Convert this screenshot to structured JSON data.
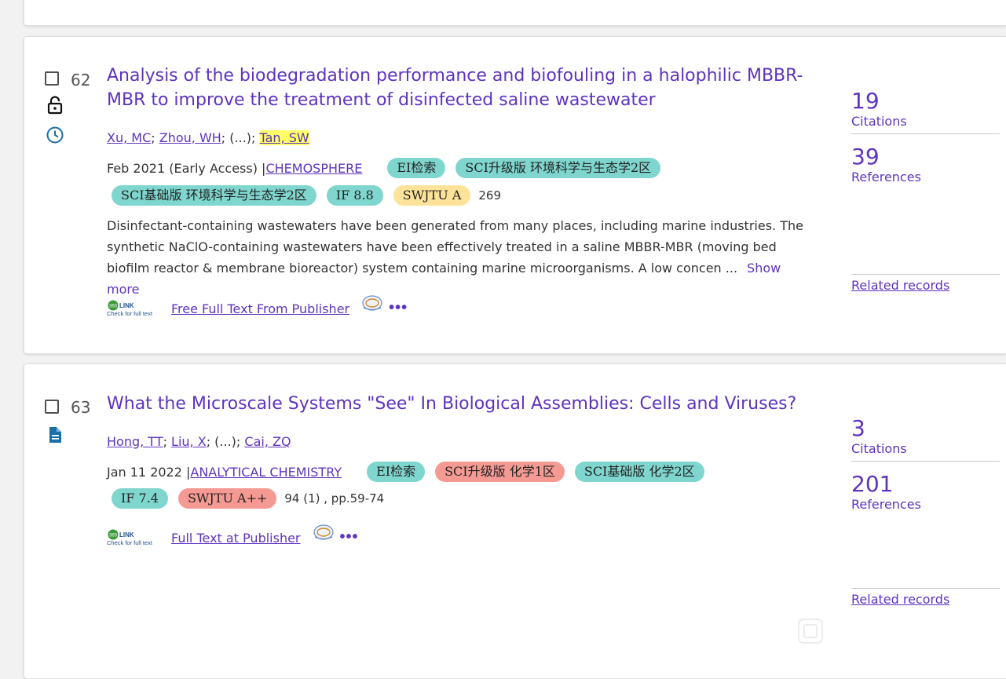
{
  "records": [
    {
      "number": "62",
      "title": "Analysis of the biodegradation performance and biofouling in a halophilic MBBR-MBR to improve the treatment of disinfected saline wastewater",
      "authors": {
        "a1": "Xu, MC",
        "a2": "Zhou, WH",
        "sep": "; (...); ",
        "a3": "Tan, SW"
      },
      "date": "Feb 2021 (Early Access) | ",
      "journal": "CHEMOSPHERE",
      "badges": [
        "EI检索",
        "SCI升级版 环境科学与生态学2区",
        "SCI基础版 环境科学与生态学2区",
        "IF 8.8",
        "SWJTU A"
      ],
      "volume": "269",
      "abstract": "Disinfectant-containing wastewaters have been generated from many places, including marine industries. The synthetic NaClO-containing wastewaters have been effectively treated in a saline MBBR-MBR (moving bed biofilm reactor & membrane bioreactor) system containing marine microorganisms. A low concen ...",
      "show_more": "Show more",
      "link360_alt": "360LINK Check for full text",
      "fulltext": "Free Full Text From Publisher",
      "more": "•••",
      "citations": "19",
      "citations_label": "Citations",
      "references": "39",
      "references_label": "References",
      "related": "Related records",
      "icons": [
        "lock-open-icon",
        "clock-icon"
      ]
    },
    {
      "number": "63",
      "title": "What the Microscale Systems \"See\" In Biological Assemblies: Cells and Viruses?",
      "authors": {
        "a1": "Hong, TT",
        "a2": "Liu, X",
        "sep": "; (...); ",
        "a3": "Cai, ZQ"
      },
      "date": "Jan 11 2022 | ",
      "journal": "ANALYTICAL CHEMISTRY",
      "badges": [
        "EI检索",
        "SCI升级版 化学1区",
        "SCI基础版 化学2区",
        "IF 7.4",
        "SWJTU A++"
      ],
      "volume": "94 (1) , pp.59-74",
      "link360_alt": "360LINK Check for full text",
      "fulltext": "Full Text at Publisher",
      "more": "•••",
      "citations": "3",
      "citations_label": "Citations",
      "references": "201",
      "references_label": "References",
      "related": "Related records",
      "icons": [
        "document-icon"
      ]
    }
  ],
  "colors": {
    "accent": "#5e33bf",
    "badge_teal": "#7fd6ce",
    "badge_yellow": "#fde39a",
    "badge_red": "#f49a93",
    "highlight": "#ffff66"
  }
}
